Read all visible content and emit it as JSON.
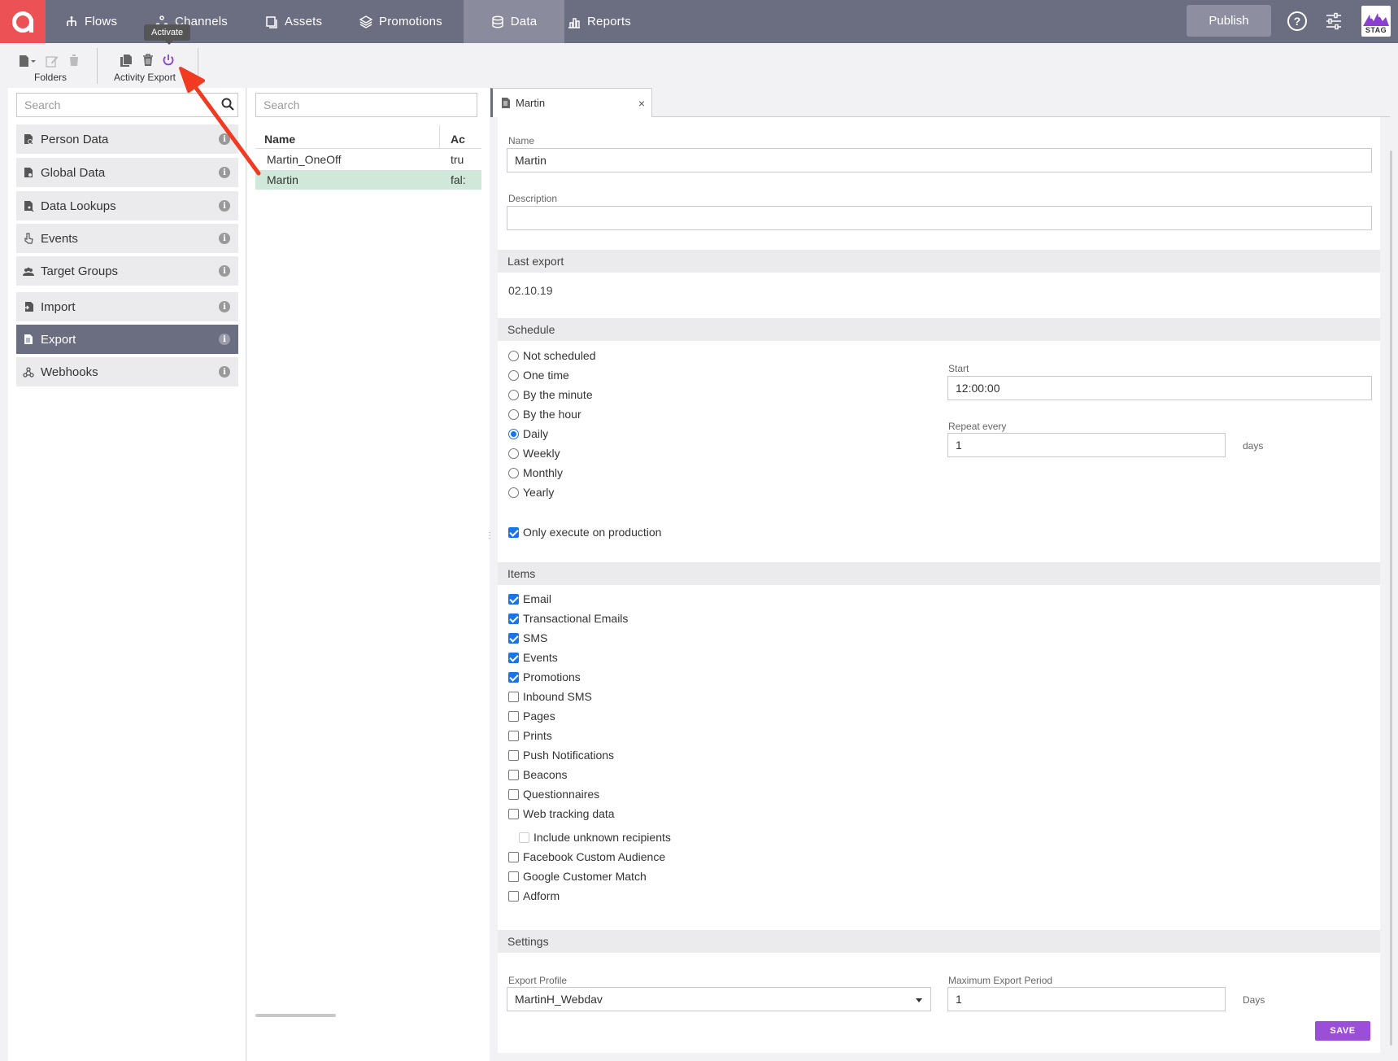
{
  "nav": {
    "items": [
      {
        "label": "Flows",
        "icon": "flows-icon"
      },
      {
        "label": "Channels",
        "icon": "channels-icon"
      },
      {
        "label": "Assets",
        "icon": "assets-icon"
      },
      {
        "label": "Promotions",
        "icon": "promotions-icon"
      },
      {
        "label": "Data",
        "icon": "data-icon",
        "active": true
      },
      {
        "label": "Reports",
        "icon": "reports-icon"
      }
    ],
    "publish_label": "Publish",
    "help_glyph": "?",
    "env_label": "STAG"
  },
  "toolbar": {
    "folders_label": "Folders",
    "activity_export_label": "Activity Export",
    "tooltip": "Activate"
  },
  "left": {
    "search_placeholder": "Search",
    "items": [
      {
        "label": "Person Data",
        "icon": "person-data-icon"
      },
      {
        "label": "Global Data",
        "icon": "global-data-icon"
      },
      {
        "label": "Data Lookups",
        "icon": "data-lookups-icon"
      },
      {
        "label": "Events",
        "icon": "events-icon"
      },
      {
        "label": "Target Groups",
        "icon": "target-groups-icon"
      },
      {
        "label": "Import",
        "icon": "import-icon"
      },
      {
        "label": "Export",
        "icon": "export-icon",
        "active": true
      },
      {
        "label": "Webhooks",
        "icon": "webhooks-icon"
      }
    ],
    "info_glyph": "i"
  },
  "middle": {
    "search_placeholder": "Search",
    "columns": [
      "Name",
      "Ac"
    ],
    "rows": [
      {
        "name": "Martin_OneOff",
        "active": "tru"
      },
      {
        "name": "Martin",
        "active": "fal:",
        "selected": true
      }
    ]
  },
  "tab": {
    "label": "Martin",
    "close": "×"
  },
  "form": {
    "name_label": "Name",
    "name_value": "Martin",
    "description_label": "Description",
    "description_value": "",
    "last_export_title": "Last export",
    "last_export_value": "02.10.19",
    "schedule_title": "Schedule",
    "schedule_options": [
      {
        "label": "Not scheduled",
        "checked": false
      },
      {
        "label": "One time",
        "checked": false
      },
      {
        "label": "By the minute",
        "checked": false
      },
      {
        "label": "By the hour",
        "checked": false
      },
      {
        "label": "Daily",
        "checked": true
      },
      {
        "label": "Weekly",
        "checked": false
      },
      {
        "label": "Monthly",
        "checked": false
      },
      {
        "label": "Yearly",
        "checked": false
      }
    ],
    "start_label": "Start",
    "start_value": "12:00:00",
    "repeat_label": "Repeat every",
    "repeat_value": "1",
    "repeat_unit": "days",
    "only_production_label": "Only execute on production",
    "only_production_checked": true,
    "items_title": "Items",
    "items": [
      {
        "label": "Email",
        "checked": true
      },
      {
        "label": "Transactional Emails",
        "checked": true
      },
      {
        "label": "SMS",
        "checked": true
      },
      {
        "label": "Events",
        "checked": true
      },
      {
        "label": "Promotions",
        "checked": true
      },
      {
        "label": "Inbound SMS",
        "checked": false
      },
      {
        "label": "Pages",
        "checked": false
      },
      {
        "label": "Prints",
        "checked": false
      },
      {
        "label": "Push Notifications",
        "checked": false
      },
      {
        "label": "Beacons",
        "checked": false
      },
      {
        "label": "Questionnaires",
        "checked": false
      },
      {
        "label": "Web tracking data",
        "checked": false
      }
    ],
    "unknown_recipients_label": "Include unknown recipients",
    "items_after": [
      {
        "label": "Facebook Custom Audience",
        "checked": false
      },
      {
        "label": "Google Customer Match",
        "checked": false
      },
      {
        "label": "Adform",
        "checked": false
      }
    ],
    "settings_title": "Settings",
    "export_profile_label": "Export Profile",
    "export_profile_value": "MartinH_Webdav",
    "max_period_label": "Maximum Export Period",
    "max_period_value": "1",
    "max_period_unit": "Days",
    "save_label": "SAVE"
  },
  "colors": {
    "nav_bg": "#6b6d80",
    "logo_red": "#ec5156",
    "accent_purple": "#9b4fd8",
    "selected_row": "#cfe8d9",
    "check_blue": "#1b73e8",
    "annotation_arrow": "#f03b22"
  }
}
